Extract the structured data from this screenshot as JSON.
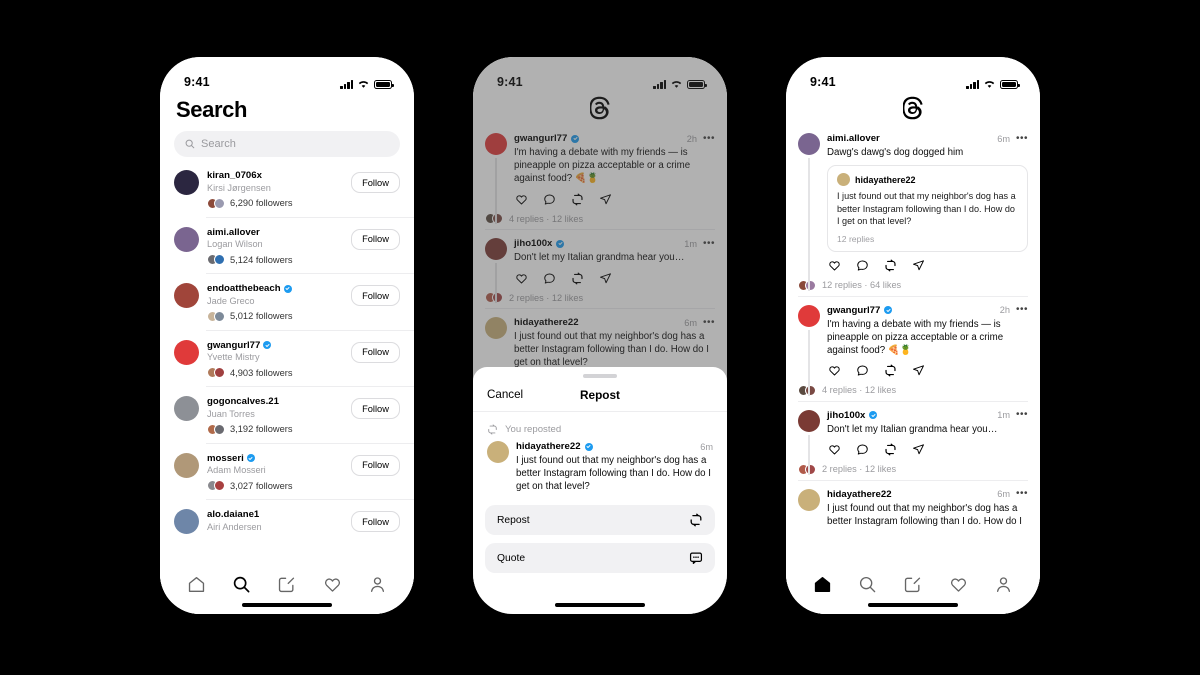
{
  "status_bar": {
    "time": "9:41"
  },
  "phone1": {
    "title": "Search",
    "search": {
      "placeholder": "Search"
    },
    "users": [
      {
        "username": "kiran_0706x",
        "fullname": "Kirsi Jørgensen",
        "followers": "6,290 followers",
        "verified": false,
        "follow_label": "Follow",
        "avatar": "#2b2640",
        "f1": "#8c4a3a",
        "f2": "#9a9ab0"
      },
      {
        "username": "aimi.allover",
        "fullname": "Logan Wilson",
        "followers": "5,124 followers",
        "verified": false,
        "follow_label": "Follow",
        "avatar": "#7a6590",
        "f1": "#6b6b70",
        "f2": "#2f6fb0"
      },
      {
        "username": "endoatthebeach",
        "fullname": "Jade Greco",
        "followers": "5,012 followers",
        "verified": true,
        "follow_label": "Follow",
        "avatar": "#a0453a",
        "f1": "#c8b49a",
        "f2": "#7d8a99"
      },
      {
        "username": "gwangurl77",
        "fullname": "Yvette Mistry",
        "followers": "4,903 followers",
        "verified": true,
        "follow_label": "Follow",
        "avatar": "#e03a3a",
        "f1": "#b07a5a",
        "f2": "#a04040"
      },
      {
        "username": "gogoncalves.21",
        "fullname": "Juan Torres",
        "followers": "3,192 followers",
        "verified": false,
        "follow_label": "Follow",
        "avatar": "#8d9096",
        "f1": "#b06a4a",
        "f2": "#6a6a70"
      },
      {
        "username": "mosseri",
        "fullname": "Adam Mosseri",
        "followers": "3,027 followers",
        "verified": true,
        "follow_label": "Follow",
        "avatar": "#b09878",
        "f1": "#8a8a8f",
        "f2": "#a84040"
      },
      {
        "username": "alo.daiane1",
        "fullname": "Airi Andersen",
        "followers": "",
        "verified": false,
        "follow_label": "Follow",
        "avatar": "#6e86a8",
        "f1": "#8a8a8f",
        "f2": "#a84040"
      }
    ],
    "tabbar": {
      "items": [
        "home-icon",
        "search-icon",
        "compose-icon",
        "heart-icon",
        "profile-icon"
      ],
      "active": "search-icon"
    }
  },
  "phone2": {
    "brand": "threads-logo",
    "posts": [
      {
        "username": "gwangurl77",
        "verified": true,
        "time": "2h",
        "text": "I'm having a debate with my friends — is pineapple on pizza acceptable or a crime against food? 🍕🍍",
        "stats": "4 replies · 12 likes",
        "avatar": "#e03a3a",
        "f1": "#5a4a40",
        "f2": "#7a4a44"
      },
      {
        "username": "jiho100x",
        "verified": true,
        "time": "1m",
        "text": "Don't let my Italian grandma hear you…",
        "stats": "2 replies · 12 likes",
        "avatar": "#7a3a34",
        "f1": "#b05a4a",
        "f2": "#a04848"
      },
      {
        "username": "hidayathere22",
        "verified": false,
        "time": "6m",
        "text": "I just found out that my neighbor's dog has a better Instagram following than I do. How do I get on that level?",
        "stats": "",
        "avatar": "#c9b07a",
        "f1": "#8a8a8f",
        "f2": "#a84040"
      }
    ],
    "sheet": {
      "cancel_label": "Cancel",
      "title": "Repost",
      "reposted_note": "You reposted",
      "post": {
        "username": "hidayathere22",
        "verified": true,
        "time": "6m",
        "text": "I just found out that my neighbor's dog has a better Instagram following than I do. How do I get on that level?",
        "avatar": "#c9b07a"
      },
      "options": [
        {
          "label": "Repost",
          "icon": "repost-icon"
        },
        {
          "label": "Quote",
          "icon": "quote-icon"
        }
      ]
    }
  },
  "phone3": {
    "brand": "threads-logo",
    "posts": [
      {
        "username": "aimi.allover",
        "verified": false,
        "time": "6m",
        "text": "Dawg's dawg's dog dogged him",
        "stats": "12 replies · 64 likes",
        "avatar": "#7a6590",
        "f1": "#8a4a3a",
        "f2": "#9a7aa0",
        "quote": {
          "username": "hidayathere22",
          "text": "I just found out that my neighbor's dog has a better Instagram following than I do. How do I get on that level?",
          "replies": "12 replies",
          "avatar": "#c9b07a"
        }
      },
      {
        "username": "gwangurl77",
        "verified": true,
        "time": "2h",
        "text": "I'm having a debate with my friends — is pineapple on pizza acceptable or a crime against food? 🍕🍍",
        "stats": "4 replies · 12 likes",
        "avatar": "#e03a3a",
        "f1": "#5a4a40",
        "f2": "#7a4a44"
      },
      {
        "username": "jiho100x",
        "verified": true,
        "time": "1m",
        "text": "Don't let my Italian grandma hear you…",
        "stats": "2 replies · 12 likes",
        "avatar": "#7a3a34",
        "f1": "#b05a4a",
        "f2": "#a04848"
      },
      {
        "username": "hidayathere22",
        "verified": false,
        "time": "6m",
        "text": "I just found out that my neighbor's dog has a better Instagram following than I do. How do I",
        "stats": "",
        "avatar": "#c9b07a",
        "f1": "#8a8a8f",
        "f2": "#a84040"
      }
    ],
    "tabbar": {
      "items": [
        "home-icon",
        "search-icon",
        "compose-icon",
        "heart-icon",
        "profile-icon"
      ],
      "active": "home-icon"
    }
  }
}
